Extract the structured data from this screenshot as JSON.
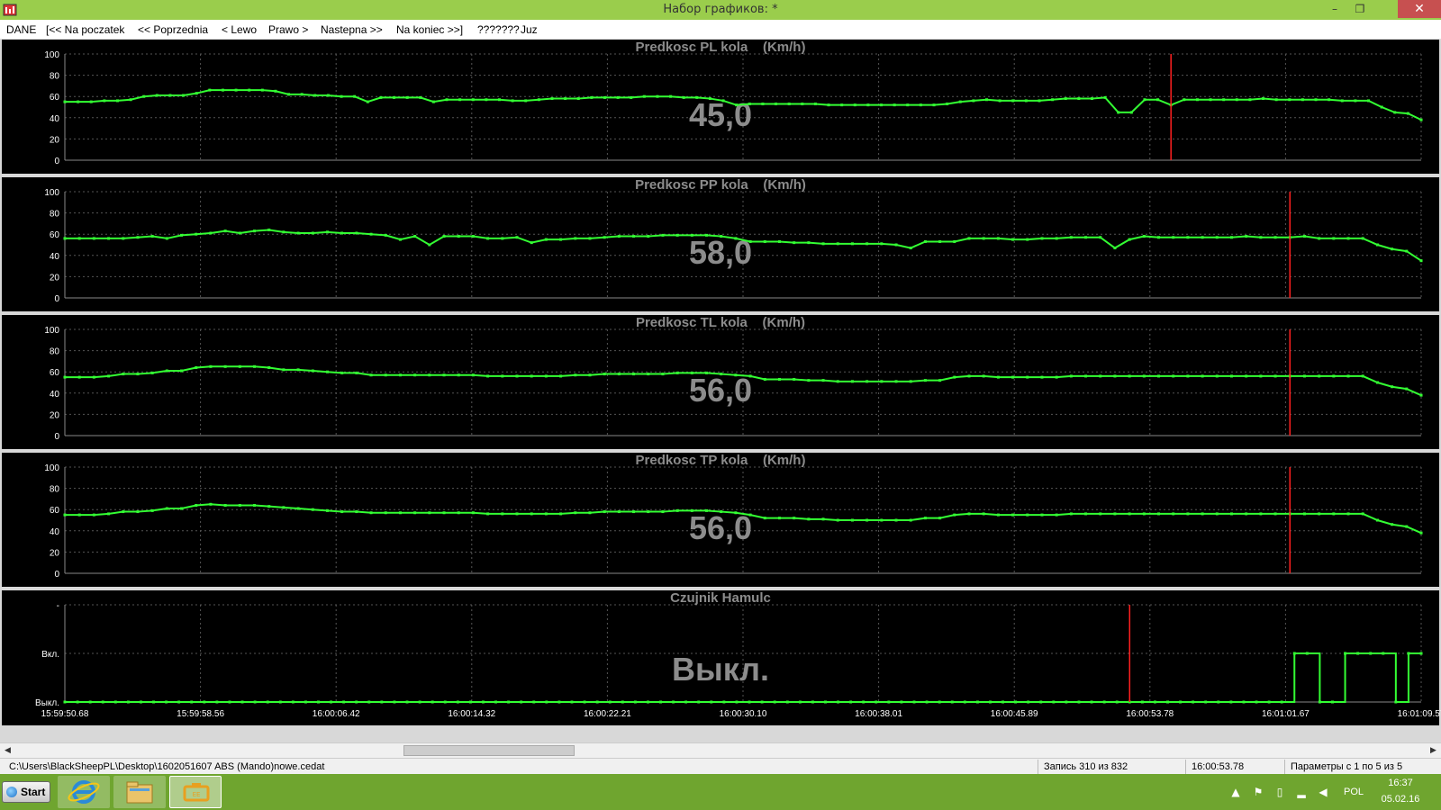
{
  "window": {
    "title": "Набор графиков: *",
    "controls": {
      "minimize": "–",
      "restore": "❐",
      "close": "✕"
    }
  },
  "menu": [
    "DANE",
    "[<< Na poczatek",
    "<< Poprzednia",
    "< Lewo",
    "Prawo >",
    "Nastepna >>",
    "Na koniec >>]",
    "???????",
    "Juz"
  ],
  "chart_data": [
    {
      "type": "line",
      "title": "Predkosc PL kola    (Km/h)",
      "current_value": "45,0",
      "ylim": [
        0,
        100
      ],
      "yticks": [
        "0",
        "20",
        "40",
        "60",
        "80",
        "100"
      ],
      "values": [
        55,
        55,
        55,
        56,
        56,
        57,
        60,
        61,
        61,
        61,
        63,
        66,
        66,
        66,
        66,
        66,
        65,
        62,
        62,
        61,
        61,
        60,
        60,
        55,
        59,
        59,
        59,
        59,
        55,
        57,
        57,
        57,
        57,
        57,
        56,
        56,
        57,
        58,
        58,
        58,
        59,
        59,
        59,
        59,
        60,
        60,
        60,
        59,
        59,
        58,
        56,
        52,
        53,
        53,
        53,
        53,
        53,
        53,
        52,
        52,
        52,
        52,
        52,
        52,
        52,
        52,
        52,
        53,
        55,
        56,
        57,
        56,
        56,
        56,
        56,
        57,
        58,
        58,
        58,
        59,
        45,
        45,
        57,
        57,
        52,
        57,
        57,
        57,
        57,
        57,
        57,
        58,
        57,
        57,
        57,
        57,
        57,
        56,
        56,
        56,
        50,
        45,
        44,
        38
      ],
      "line_color": "#33ff33",
      "cursor_index": 84
    },
    {
      "type": "line",
      "title": "Predkosc PP kola    (Km/h)",
      "current_value": "58,0",
      "ylim": [
        0,
        100
      ],
      "yticks": [
        "0",
        "20",
        "40",
        "60",
        "80",
        "100"
      ],
      "values": [
        56,
        56,
        56,
        56,
        56,
        57,
        58,
        56,
        59,
        60,
        61,
        63,
        61,
        63,
        64,
        62,
        61,
        61,
        62,
        61,
        61,
        60,
        59,
        55,
        58,
        50,
        58,
        58,
        58,
        56,
        56,
        57,
        52,
        55,
        55,
        56,
        56,
        57,
        58,
        58,
        58,
        59,
        59,
        59,
        59,
        58,
        56,
        53,
        53,
        53,
        52,
        52,
        51,
        51,
        51,
        51,
        51,
        50,
        47,
        53,
        53,
        53,
        56,
        56,
        56,
        55,
        55,
        56,
        56,
        57,
        57,
        57,
        47,
        55,
        58,
        57,
        57,
        57,
        57,
        57,
        57,
        58,
        57,
        57,
        57,
        58,
        56,
        56,
        56,
        56,
        50,
        46,
        44,
        35
      ],
      "line_color": "#33ff33",
      "cursor_index": 84
    },
    {
      "type": "line",
      "title": "Predkosc TL kola    (Km/h)",
      "current_value": "56,0",
      "ylim": [
        0,
        100
      ],
      "yticks": [
        "0",
        "20",
        "40",
        "60",
        "80",
        "100"
      ],
      "values": [
        55,
        55,
        55,
        56,
        58,
        58,
        59,
        61,
        61,
        64,
        65,
        65,
        65,
        65,
        64,
        62,
        62,
        61,
        60,
        59,
        59,
        57,
        57,
        57,
        57,
        57,
        57,
        57,
        57,
        56,
        56,
        56,
        56,
        56,
        56,
        57,
        57,
        58,
        58,
        58,
        58,
        58,
        59,
        59,
        59,
        58,
        57,
        56,
        53,
        53,
        53,
        52,
        52,
        51,
        51,
        51,
        51,
        51,
        51,
        52,
        52,
        55,
        56,
        56,
        55,
        55,
        55,
        55,
        55,
        56,
        56,
        56,
        56,
        56,
        56,
        56,
        56,
        56,
        56,
        56,
        56,
        56,
        56,
        56,
        56,
        56,
        56,
        56,
        56,
        56,
        50,
        46,
        44,
        38
      ],
      "line_color": "#33ff33",
      "cursor_index": 84
    },
    {
      "type": "line",
      "title": "Predkosc TP kola    (Km/h)",
      "current_value": "56,0",
      "ylim": [
        0,
        100
      ],
      "yticks": [
        "0",
        "20",
        "40",
        "60",
        "80",
        "100"
      ],
      "values": [
        55,
        55,
        55,
        56,
        58,
        58,
        59,
        61,
        61,
        64,
        65,
        64,
        64,
        64,
        63,
        62,
        61,
        60,
        59,
        58,
        58,
        57,
        57,
        57,
        57,
        57,
        57,
        57,
        57,
        56,
        56,
        56,
        56,
        56,
        56,
        57,
        57,
        58,
        58,
        58,
        58,
        58,
        59,
        59,
        59,
        58,
        57,
        55,
        52,
        52,
        52,
        51,
        51,
        50,
        50,
        50,
        50,
        50,
        50,
        52,
        52,
        55,
        56,
        56,
        55,
        55,
        55,
        55,
        55,
        56,
        56,
        56,
        56,
        56,
        56,
        56,
        56,
        56,
        56,
        56,
        56,
        56,
        56,
        56,
        56,
        56,
        56,
        56,
        56,
        56,
        50,
        46,
        44,
        38
      ],
      "line_color": "#33ff33",
      "cursor_index": 84
    },
    {
      "type": "line",
      "title": "Czujnik Hamulc",
      "current_value": "Выкл.",
      "ylim": [
        0,
        1
      ],
      "yticks": [
        "Выкл.",
        "Вкл.",
        "-"
      ],
      "step": true,
      "values": [
        0,
        0,
        0,
        0,
        0,
        0,
        0,
        0,
        0,
        0,
        0,
        0,
        0,
        0,
        0,
        0,
        0,
        0,
        0,
        0,
        0,
        0,
        0,
        0,
        0,
        0,
        0,
        0,
        0,
        0,
        0,
        0,
        0,
        0,
        0,
        0,
        0,
        0,
        0,
        0,
        0,
        0,
        0,
        0,
        0,
        0,
        0,
        0,
        0,
        0,
        0,
        0,
        0,
        0,
        0,
        0,
        0,
        0,
        0,
        0,
        0,
        0,
        0,
        0,
        0,
        0,
        0,
        0,
        0,
        0,
        0,
        0,
        0,
        0,
        0,
        0,
        0,
        0,
        0,
        0,
        0,
        0,
        0,
        0,
        0,
        0,
        0,
        0,
        0,
        0,
        0,
        0,
        0,
        0,
        0,
        0,
        0,
        1,
        1,
        0,
        0,
        1,
        1,
        1,
        1,
        0,
        1,
        1
      ],
      "line_color": "#33ff33",
      "cursor_index": 84,
      "xticks": [
        "15:59:50.68",
        "15:59:58.56",
        "16:00:06.42",
        "16:00:14.32",
        "16:00:22.21",
        "16:00:30.10",
        "16:00:38.01",
        "16:00:45.89",
        "16:00:53.78",
        "16:01:01.67",
        "16:01:09.57"
      ]
    }
  ],
  "status": {
    "file_path": "C:\\Users\\BlackSheepPL\\Desktop\\1602051607 ABS (Mando)nowe.cedat",
    "record": "Запись 310 из 832",
    "time": "16:00:53.78",
    "params": "Параметры с 1 по 5 из 5"
  },
  "taskbar": {
    "start_label": "Start",
    "lang": "POL",
    "time": "16:37",
    "date": "05.02.16"
  },
  "colors": {
    "chart_bg": "#000000",
    "grid": "#555555",
    "line": "#33ff33",
    "cursor": "#ff2020",
    "title_text": "#8c8c8c",
    "value_text": "#8c8c8c"
  }
}
